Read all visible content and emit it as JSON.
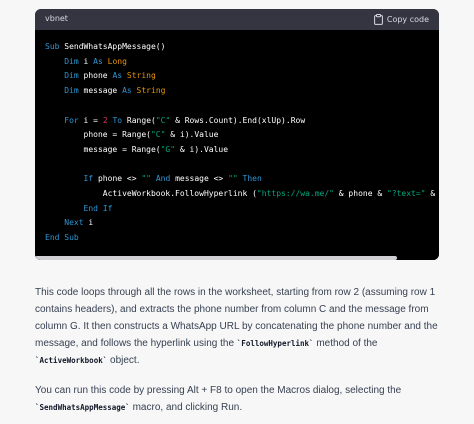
{
  "code_block": {
    "language": "vbnet",
    "copy_label": "Copy code",
    "copy_icon": "clipboard-icon",
    "syntax_colors": {
      "keyword": "#2e95d3",
      "type": "#e9950c",
      "string": "#00a67d",
      "number": "#df3079",
      "function": "#f22c3d",
      "plain": "#ffffff"
    },
    "lines": [
      [
        {
          "t": "kw",
          "v": "Sub"
        },
        {
          "t": "pl",
          "v": " SendWhatsAppMessage()"
        }
      ],
      [
        {
          "t": "pl",
          "v": "    "
        },
        {
          "t": "kw",
          "v": "Dim"
        },
        {
          "t": "pl",
          "v": " i "
        },
        {
          "t": "kw",
          "v": "As"
        },
        {
          "t": "pl",
          "v": " "
        },
        {
          "t": "ty",
          "v": "Long"
        }
      ],
      [
        {
          "t": "pl",
          "v": "    "
        },
        {
          "t": "kw",
          "v": "Dim"
        },
        {
          "t": "pl",
          "v": " phone "
        },
        {
          "t": "kw",
          "v": "As"
        },
        {
          "t": "pl",
          "v": " "
        },
        {
          "t": "ty",
          "v": "String"
        }
      ],
      [
        {
          "t": "pl",
          "v": "    "
        },
        {
          "t": "kw",
          "v": "Dim"
        },
        {
          "t": "pl",
          "v": " message "
        },
        {
          "t": "kw",
          "v": "As"
        },
        {
          "t": "pl",
          "v": " "
        },
        {
          "t": "ty",
          "v": "String"
        }
      ],
      [],
      [
        {
          "t": "pl",
          "v": "    "
        },
        {
          "t": "kw",
          "v": "For"
        },
        {
          "t": "pl",
          "v": " i = "
        },
        {
          "t": "nu",
          "v": "2"
        },
        {
          "t": "pl",
          "v": " "
        },
        {
          "t": "kw",
          "v": "To"
        },
        {
          "t": "pl",
          "v": " Range("
        },
        {
          "t": "st",
          "v": "\"C\""
        },
        {
          "t": "pl",
          "v": " & Rows.Count).End(xlUp).Row"
        }
      ],
      [
        {
          "t": "pl",
          "v": "        phone = Range("
        },
        {
          "t": "st",
          "v": "\"C\""
        },
        {
          "t": "pl",
          "v": " & i).Value"
        }
      ],
      [
        {
          "t": "pl",
          "v": "        message = Range("
        },
        {
          "t": "st",
          "v": "\"G\""
        },
        {
          "t": "pl",
          "v": " & i).Value"
        }
      ],
      [],
      [
        {
          "t": "pl",
          "v": "        "
        },
        {
          "t": "kw",
          "v": "If"
        },
        {
          "t": "pl",
          "v": " phone <> "
        },
        {
          "t": "st",
          "v": "\"\""
        },
        {
          "t": "pl",
          "v": " "
        },
        {
          "t": "kw",
          "v": "And"
        },
        {
          "t": "pl",
          "v": " message <> "
        },
        {
          "t": "st",
          "v": "\"\""
        },
        {
          "t": "pl",
          "v": " "
        },
        {
          "t": "kw",
          "v": "Then"
        }
      ],
      [
        {
          "t": "pl",
          "v": "            ActiveWorkbook.FollowHyperlink ("
        },
        {
          "t": "st",
          "v": "\"https://wa.me/\""
        },
        {
          "t": "pl",
          "v": " & phone & "
        },
        {
          "t": "st",
          "v": "\"?text=\""
        },
        {
          "t": "pl",
          "v": " & m"
        }
      ],
      [
        {
          "t": "pl",
          "v": "        "
        },
        {
          "t": "kw",
          "v": "End"
        },
        {
          "t": "pl",
          "v": " "
        },
        {
          "t": "kw",
          "v": "If"
        }
      ],
      [
        {
          "t": "pl",
          "v": "    "
        },
        {
          "t": "kw",
          "v": "Next"
        },
        {
          "t": "pl",
          "v": " i"
        }
      ],
      [
        {
          "t": "kw",
          "v": "End"
        },
        {
          "t": "pl",
          "v": " "
        },
        {
          "t": "kw",
          "v": "Sub"
        }
      ]
    ]
  },
  "paragraph1": {
    "text_a": "This code loops through all the rows in the worksheet, starting from row 2 (assuming row 1 contains headers), and extracts the phone number from column C and the message from column G. It then constructs a WhatsApp URL by concatenating the phone number and the message, and follows the hyperlink using the ",
    "code_a": "`FollowHyperlink`",
    "text_b": " method of the ",
    "code_b": "`ActiveWorkbook`",
    "text_c": " object."
  },
  "paragraph2": {
    "text_a": "You can run this code by pressing Alt + F8 to open the Macros dialog, selecting the ",
    "code_a": "`SendWhatsAppMessage`",
    "text_b": " macro, and clicking Run."
  }
}
